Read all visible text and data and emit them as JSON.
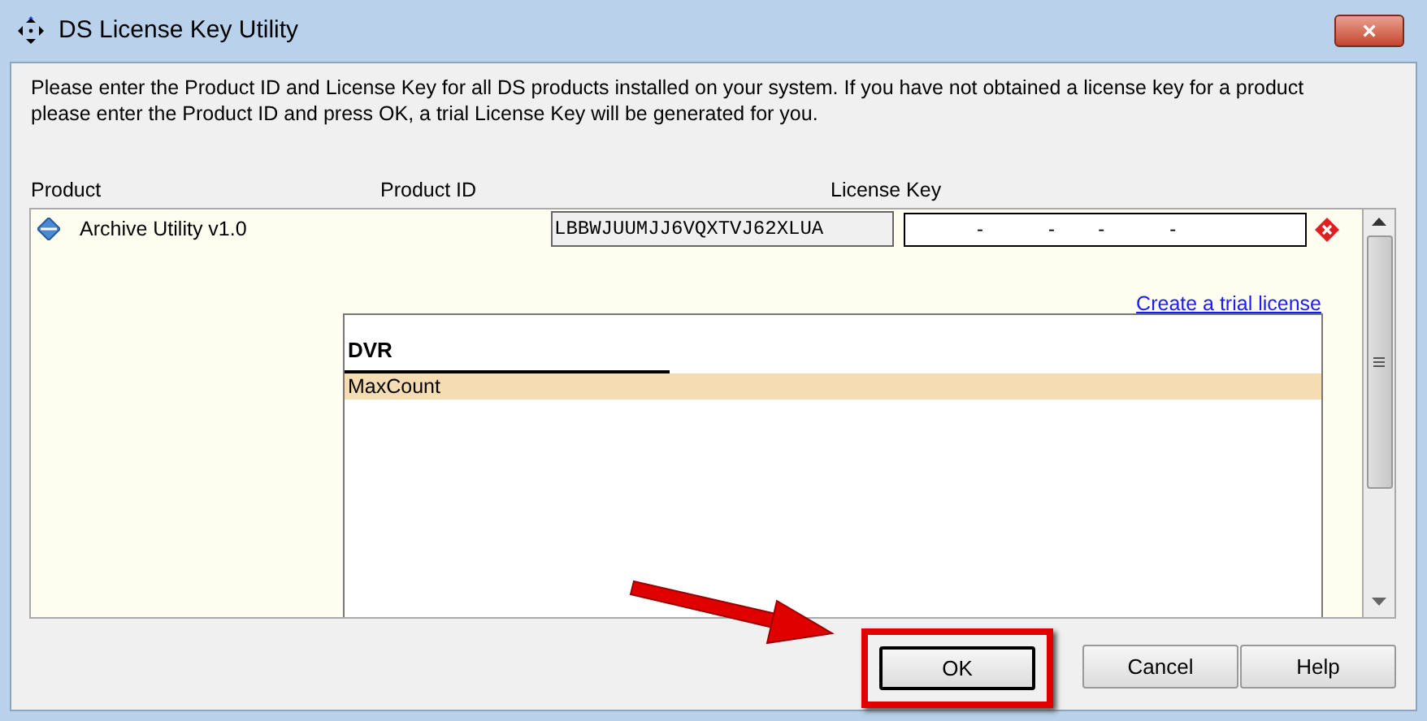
{
  "window": {
    "title": "DS License Key Utility",
    "close": "×"
  },
  "instructions": "Please enter the Product ID and License Key for all DS products installed on your system. If you have not obtained a license key for a product please enter the Product ID and press OK, a trial License Key will be generated for you.",
  "columns": [
    "Product",
    "Product ID",
    "License Key"
  ],
  "products": [
    {
      "name": "Archive Utility v1.0",
      "product_id": "LBBWJUUMJJ6VQXTVJ62XLUA",
      "license_key": "-            -        -            -",
      "error": true,
      "link": "Create a trial license",
      "features": {
        "heading": "DVR",
        "rows": [
          {
            "label": "MaxCount",
            "selected": true
          }
        ]
      }
    }
  ],
  "buttons": [
    {
      "label": "OK",
      "highlighted": true
    },
    {
      "label": "Cancel",
      "highlighted": false
    },
    {
      "label": "Help",
      "highlighted": false
    }
  ]
}
